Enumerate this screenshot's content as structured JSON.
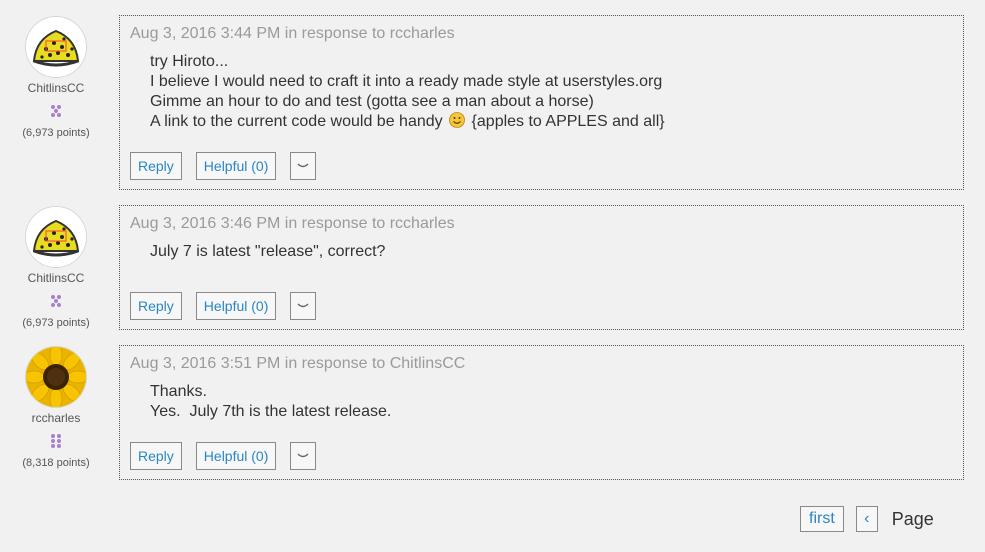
{
  "colors": {
    "background": "#f1f1f1",
    "link_blue": "#2a86c5",
    "meta_gray": "#9a9a9a",
    "rank_purple": "#a980d0"
  },
  "posts": [
    {
      "author": {
        "name": "ChitlinsCC",
        "points": "(6,973 points)",
        "avatar": "yellow-dotted-hat-avatar",
        "rank_icon": "flower-rank-icon"
      },
      "meta": "Aug 3, 2016 3:44 PM in response to rccharles",
      "lines": [
        "try Hiroto...",
        "I believe I would need to craft it into a ready made style at userstyles.org",
        "Gimme an hour to do and test (gotta see a man about a horse)",
        "A link to the current code would be handy",
        "{apples to APPLES and all}"
      ],
      "reply_label": "Reply",
      "helpful_label": "Helpful (0)",
      "more_icon": "chevron-down-icon"
    },
    {
      "author": {
        "name": "ChitlinsCC",
        "points": "(6,973 points)",
        "avatar": "yellow-dotted-hat-avatar",
        "rank_icon": "flower-rank-icon"
      },
      "meta": "Aug 3, 2016 3:46 PM in response to rccharles",
      "lines": [
        "July 7 is latest \"release\", correct?"
      ],
      "reply_label": "Reply",
      "helpful_label": "Helpful (0)",
      "more_icon": "chevron-down-icon"
    },
    {
      "author": {
        "name": "rccharles",
        "points": "(8,318 points)",
        "avatar": "sunflower-avatar",
        "rank_icon": "grid-dots-rank-icon"
      },
      "meta": "Aug 3, 2016 3:51 PM in response to ChitlinsCC",
      "lines": [
        "Thanks.",
        "Yes.  July 7th is the latest release."
      ],
      "reply_label": "Reply",
      "helpful_label": "Helpful (0)",
      "more_icon": "chevron-down-icon"
    }
  ],
  "pager": {
    "first_label": "first",
    "prev_icon": "chevron-left-icon",
    "prev_glyph": "‹",
    "page_label": "Page"
  }
}
